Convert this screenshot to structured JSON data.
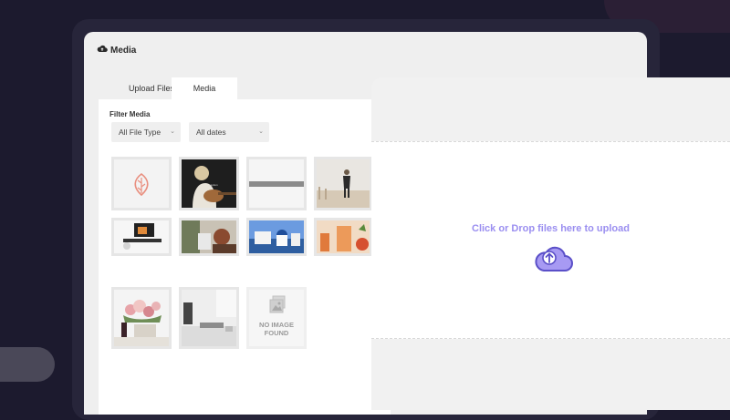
{
  "header": {
    "title": "Media"
  },
  "tabs": [
    {
      "label": "Upload Files",
      "active": false
    },
    {
      "label": "Media Library",
      "active": true
    }
  ],
  "filter": {
    "label": "Filter Media",
    "type_select": "All File Type",
    "date_select": "All dates"
  },
  "thumbnails": [
    {
      "caption": ""
    },
    {
      "caption": ""
    },
    {
      "caption": ""
    },
    {
      "caption": ""
    },
    {
      "caption": ""
    },
    {
      "caption": ""
    },
    {
      "caption": ""
    },
    {
      "caption": ""
    },
    {
      "caption": ""
    },
    {
      "caption": ""
    },
    {
      "caption": "NO IMAGE FOUND"
    }
  ],
  "upload": {
    "drop_text": "Click or Drop files here to upload"
  },
  "colors": {
    "background": "#1c1a2e",
    "accent": "#9a8ef0",
    "panel": "#efefef"
  },
  "icons": {
    "header": "cloud-icon",
    "upload": "cloud-upload-icon",
    "no_image": "image-placeholder-icon"
  }
}
